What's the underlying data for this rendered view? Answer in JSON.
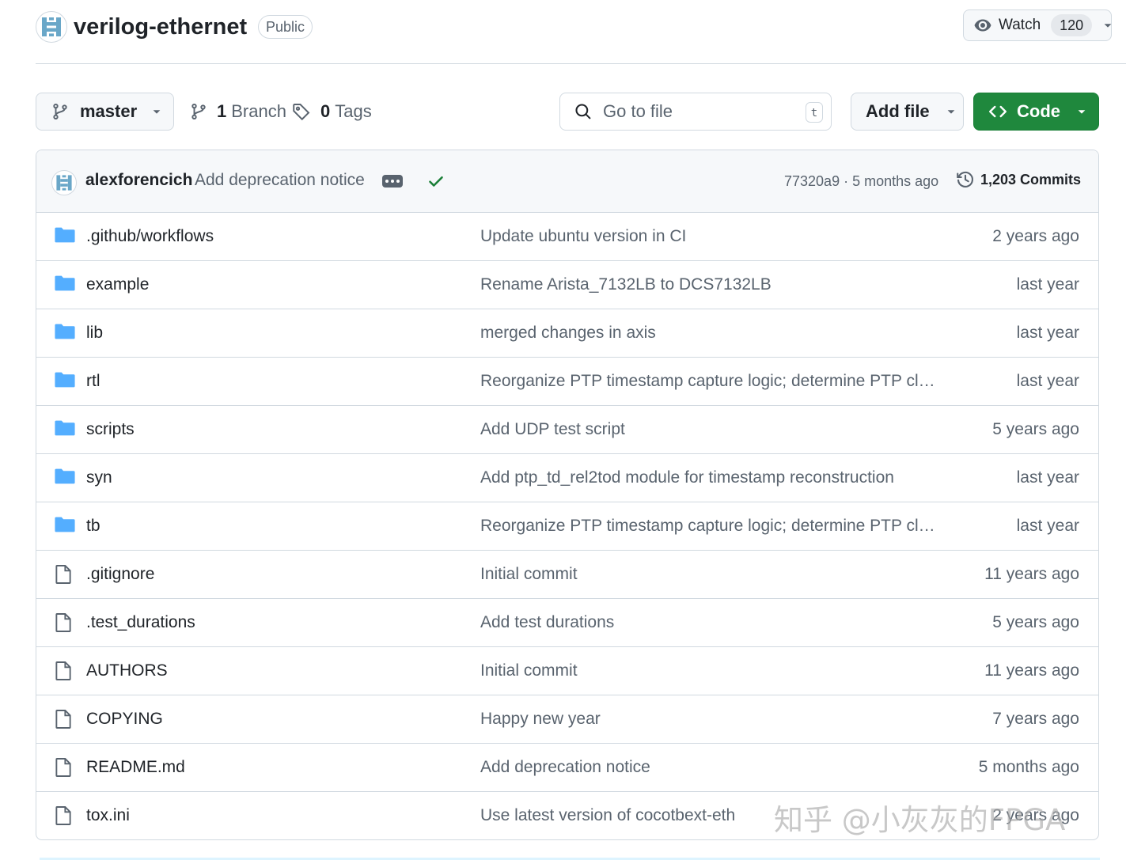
{
  "repo": {
    "name": "verilog-ethernet",
    "visibility": "Public",
    "watch_label": "Watch",
    "watch_count": "120"
  },
  "toolbar": {
    "branch": "master",
    "branch_count": "1",
    "branch_word": "Branch",
    "tag_count": "0",
    "tag_word": "Tags",
    "search_placeholder": "Go to file",
    "search_shortcut": "t",
    "add_file_label": "Add file",
    "code_label": "Code"
  },
  "latest_commit": {
    "author": "alexforencich",
    "message": "Add deprecation notice",
    "hash_and_time": "77320a9 · 5 months ago",
    "commits_label": "1,203 Commits",
    "status_color": "#1a7f37"
  },
  "files": [
    {
      "type": "folder",
      "name": ".github/workflows",
      "message": "Update ubuntu version in CI",
      "time": "2 years ago"
    },
    {
      "type": "folder",
      "name": "example",
      "message": "Rename Arista_7132LB to DCS7132LB",
      "time": "last year"
    },
    {
      "type": "folder",
      "name": "lib",
      "message": "merged changes in axis",
      "time": "last year"
    },
    {
      "type": "folder",
      "name": "rtl",
      "message": "Reorganize PTP timestamp capture logic; determine PTP cloc...",
      "time": "last year"
    },
    {
      "type": "folder",
      "name": "scripts",
      "message": "Add UDP test script",
      "time": "5 years ago"
    },
    {
      "type": "folder",
      "name": "syn",
      "message": "Add ptp_td_rel2tod module for timestamp reconstruction",
      "time": "last year"
    },
    {
      "type": "folder",
      "name": "tb",
      "message": "Reorganize PTP timestamp capture logic; determine PTP cloc...",
      "time": "last year"
    },
    {
      "type": "file",
      "name": ".gitignore",
      "message": "Initial commit",
      "time": "11 years ago"
    },
    {
      "type": "file",
      "name": ".test_durations",
      "message": "Add test durations",
      "time": "5 years ago"
    },
    {
      "type": "file",
      "name": "AUTHORS",
      "message": "Initial commit",
      "time": "11 years ago"
    },
    {
      "type": "file",
      "name": "COPYING",
      "message": "Happy new year",
      "time": "7 years ago"
    },
    {
      "type": "file",
      "name": "README.md",
      "message": "Add deprecation notice",
      "time": "5 months ago"
    },
    {
      "type": "file",
      "name": "tox.ini",
      "message": "Use latest version of cocotbext-eth",
      "time": "2 years ago"
    }
  ],
  "watermark": "知乎 @小灰灰的FPGA",
  "colors": {
    "folder_icon": "#54aeff",
    "file_icon": "#59636e",
    "code_button": "#1f883d",
    "avatar_accent": "#6aa7c8"
  }
}
